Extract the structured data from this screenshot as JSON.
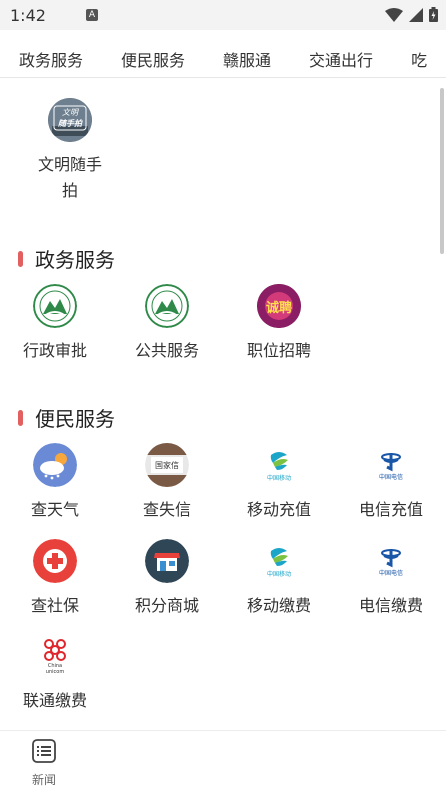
{
  "status": {
    "time": "1:42",
    "notification_letter": "A"
  },
  "tabs": [
    "政务服务",
    "便民服务",
    "赣服通",
    "交通出行",
    "吃"
  ],
  "featured": {
    "label_line1": "文明随手",
    "label_line2": "拍",
    "icon_text_1": "文明",
    "icon_text_2": "随手拍"
  },
  "sections": {
    "gov": {
      "title": "政务服务",
      "items": [
        {
          "label": "行政审批",
          "icon": "gov-emblem-icon"
        },
        {
          "label": "公共服务",
          "icon": "gov-emblem-icon"
        },
        {
          "label": "职位招聘",
          "icon": "recruit-icon",
          "icon_text": "诚聘"
        }
      ]
    },
    "life": {
      "title": "便民服务",
      "items": [
        {
          "label": "查天气",
          "icon": "weather-icon"
        },
        {
          "label": "查失信",
          "icon": "credit-icon",
          "icon_text": "国家信"
        },
        {
          "label": "移动充值",
          "icon": "china-mobile-icon",
          "icon_text": "中国移动"
        },
        {
          "label": "电信充值",
          "icon": "china-telecom-icon",
          "icon_text": "中国电信"
        },
        {
          "label": "查社保",
          "icon": "social-security-icon"
        },
        {
          "label": "积分商城",
          "icon": "shop-icon"
        },
        {
          "label": "移动缴费",
          "icon": "china-mobile-icon",
          "icon_text": "中国移动"
        },
        {
          "label": "电信缴费",
          "icon": "china-telecom-icon",
          "icon_text": "中国电信"
        },
        {
          "label": "联通缴费",
          "icon": "china-unicom-icon",
          "icon_text": "China unicom"
        }
      ]
    }
  },
  "bottom_nav": {
    "news_label": "新闻"
  },
  "colors": {
    "section_bar": "#e26060",
    "mobile": "#1aa5c9",
    "telecom": "#1a56a8",
    "unicom": "#e0262d"
  }
}
